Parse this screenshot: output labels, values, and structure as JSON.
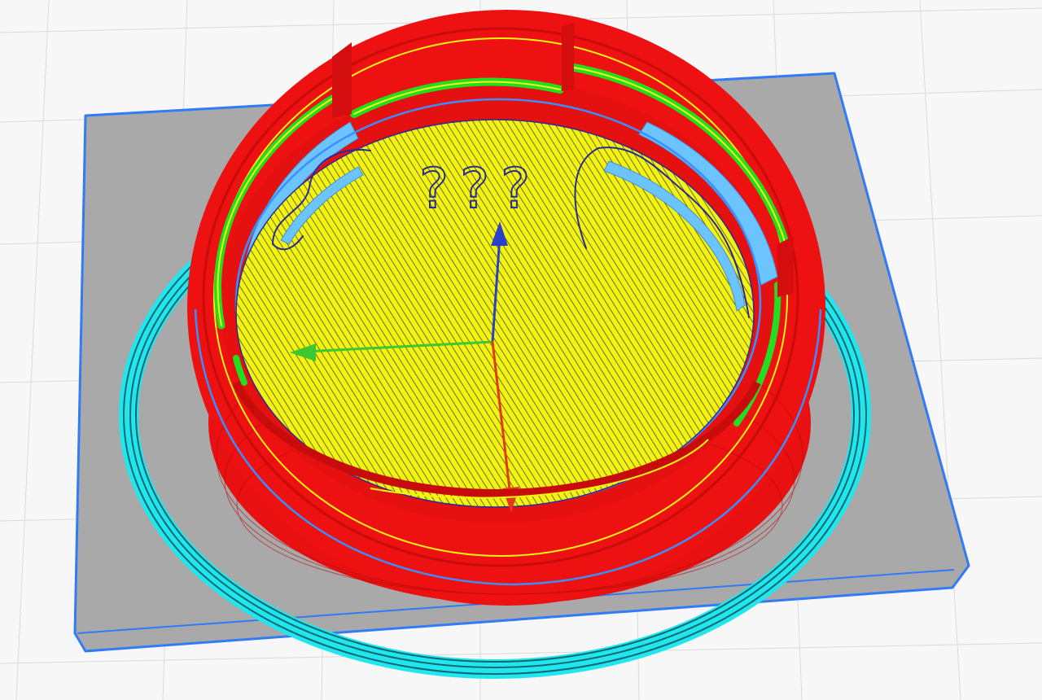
{
  "viewer": {
    "annotation_text": "???",
    "axes": {
      "x_label": "",
      "y_label": "",
      "z_label": ""
    },
    "colors": {
      "background": "#f7f7f7",
      "grid": "#d9d9d9",
      "build_plate": "#a9a9a9",
      "plate_outline": "#2f7cf6",
      "wall": "#ee1111",
      "wall_dark": "#c90d0d",
      "infill": "#f3f311",
      "infill_line": "#4a4a14",
      "inner_wall": "#22dd22",
      "support": "#6cc4ff",
      "skirt": "#22e6ee",
      "skirt_dark": "#0a6870",
      "seam": "#3a8fff",
      "annotation": "#2a2a9a",
      "axis_x": "#e23a1a",
      "axis_y": "#3cc830",
      "axis_z": "#2a40c8"
    }
  }
}
